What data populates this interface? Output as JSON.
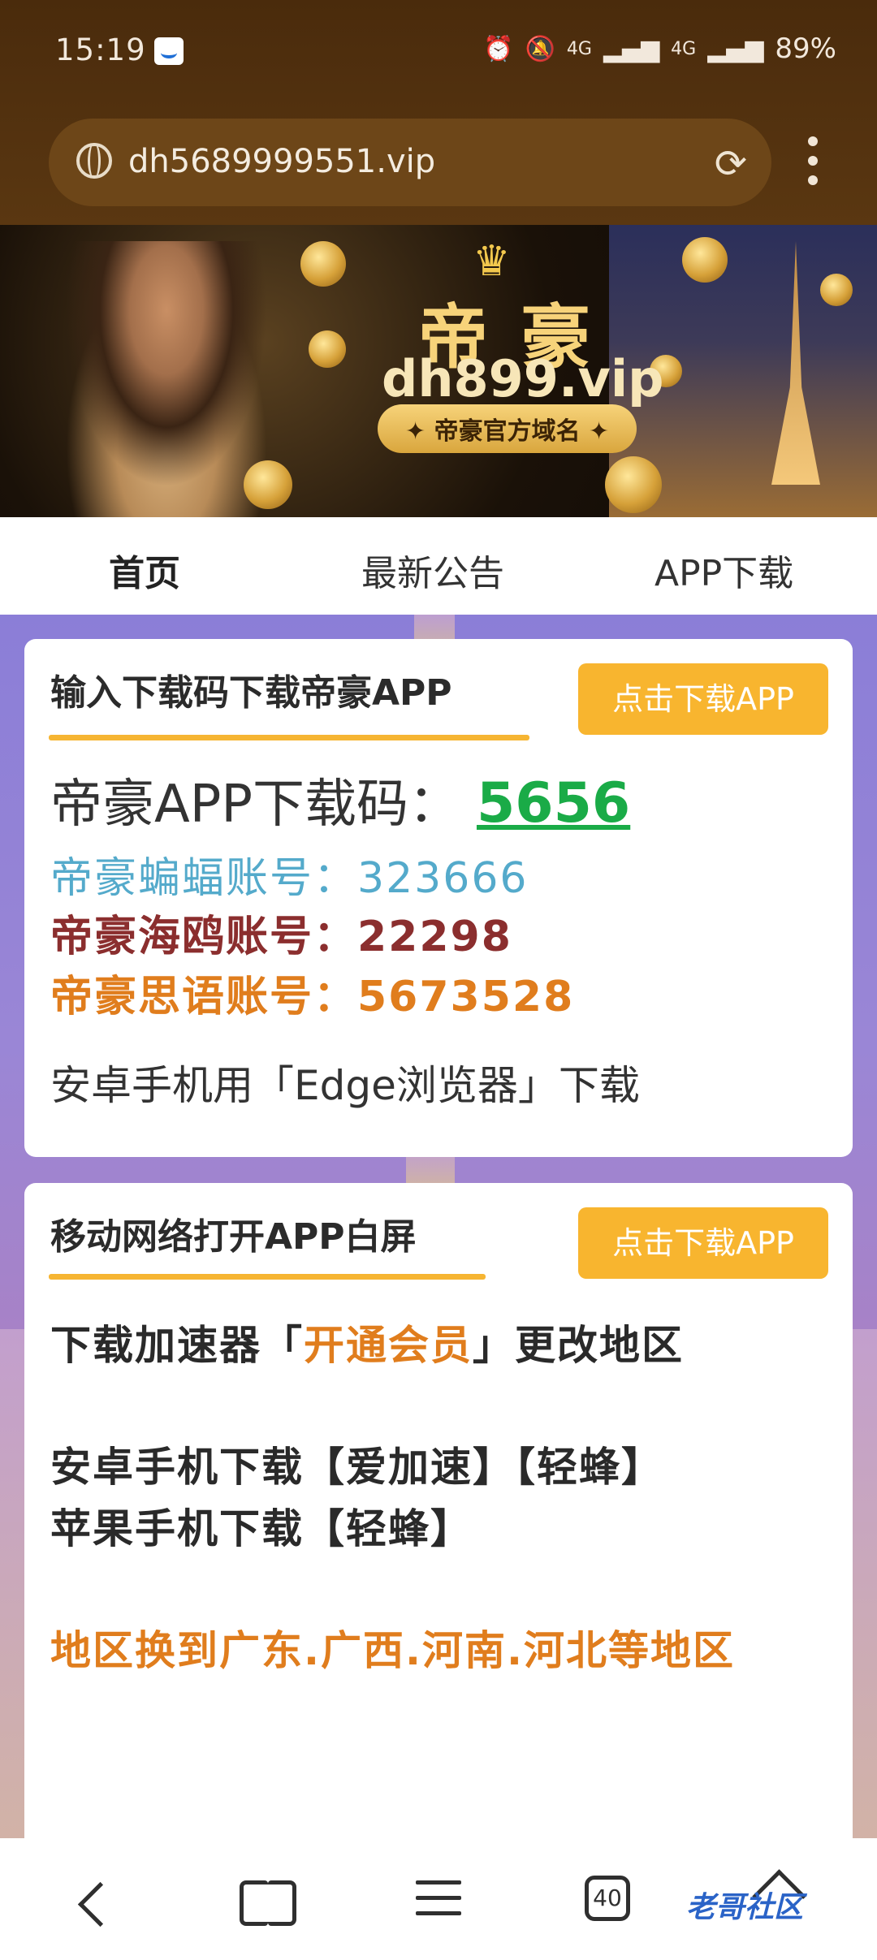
{
  "status_bar": {
    "time": "15:19",
    "network1": "4G",
    "network2": "4G",
    "battery": "89%"
  },
  "browser": {
    "url": "dh5689999551.vip",
    "open_tabs": "40"
  },
  "banner": {
    "brand_cn": "帝豪",
    "domain": "dh899.vip",
    "tagline": "✦ 帝豪官方域名 ✦"
  },
  "nav_tabs": [
    {
      "label": "首页"
    },
    {
      "label": "最新公告"
    },
    {
      "label": "APP下载"
    }
  ],
  "card1": {
    "title": "输入下载码下载帝豪APP",
    "button": "点击下载APP",
    "code_label": "帝豪APP下载码：",
    "code_value": "5656",
    "account_bat": "帝豪蝙蝠账号：323666",
    "account_gull": "帝豪海鸥账号：22298",
    "account_siyu": "帝豪思语账号：5673528",
    "tip": "安卓手机用「Edge浏览器」下载"
  },
  "card2": {
    "title": "移动网络打开APP白屏",
    "button": "点击下载APP",
    "line1_prefix": "下载加速器「",
    "line1_highlight": "开通会员",
    "line1_suffix": "」更改地区",
    "line2": "安卓手机下载【爱加速】【轻蜂】",
    "line3": "苹果手机下载【轻蜂】",
    "line4": "地区换到广东.广西.河南.河北等地区"
  },
  "watermark": "老哥社区",
  "colors": {
    "accent": "#f8b52f",
    "code_green": "#1aab47",
    "highlight_orange": "#e07d1d",
    "bat_blue": "#54aacb",
    "gull_red": "#8b2e2e"
  }
}
